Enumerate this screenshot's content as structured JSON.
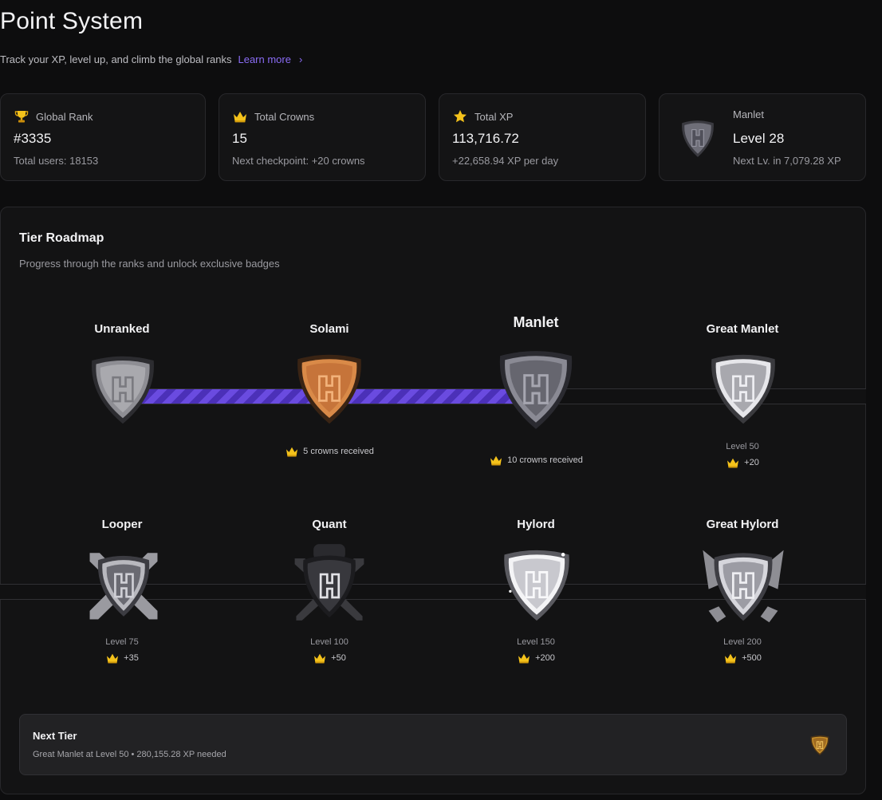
{
  "header": {
    "title": "Point System",
    "subtitle": "Track your XP, level up, and climb the global ranks",
    "learn_more": "Learn more",
    "learn_more_icon": "chevron-right-icon"
  },
  "stats": {
    "rank": {
      "label": "Global Rank",
      "value": "#3335",
      "sub": "Total users: 18153",
      "icon": "trophy-icon"
    },
    "crowns": {
      "label": "Total Crowns",
      "value": "15",
      "sub": "Next checkpoint: +20 crowns",
      "icon": "crown-icon"
    },
    "xp": {
      "label": "Total XP",
      "value": "113,716.72",
      "sub": "+22,658.94 XP per day",
      "icon": "star-icon"
    },
    "level": {
      "label": "Manlet",
      "value": "Level 28",
      "sub": "Next Lv. in 7,079.28 XP",
      "icon": "manlet-badge-icon"
    }
  },
  "roadmap": {
    "title": "Tier Roadmap",
    "subtitle": "Progress through the ranks and unlock exclusive badges",
    "progress_fraction": 0.33,
    "tiers": [
      {
        "name": "Unranked",
        "requirement": "",
        "reward": ""
      },
      {
        "name": "Solami",
        "requirement": "",
        "reward": "5 crowns received"
      },
      {
        "name": "Manlet",
        "requirement": "",
        "reward": "10 crowns received"
      },
      {
        "name": "Great Manlet",
        "requirement": "Level 50",
        "reward": "+20"
      },
      {
        "name": "Looper",
        "requirement": "Level 75",
        "reward": "+35"
      },
      {
        "name": "Quant",
        "requirement": "Level 100",
        "reward": "+50"
      },
      {
        "name": "Hylord",
        "requirement": "Level 150",
        "reward": "+200"
      },
      {
        "name": "Great Hylord",
        "requirement": "Level 200",
        "reward": "+500"
      }
    ],
    "next_tier": {
      "title": "Next Tier",
      "description": "Great Manlet at Level 50 • 280,155.28 XP needed",
      "icon": "bronze-badge-icon"
    }
  },
  "colors": {
    "accent": "#8a6cf5",
    "progress": "#6a4be0",
    "background": "#0d0d0e",
    "card": "#141415",
    "crown": "#f4c21b"
  }
}
